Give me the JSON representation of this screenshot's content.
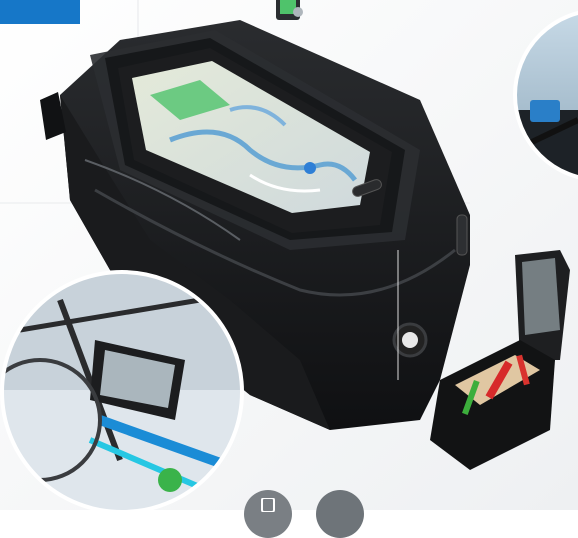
{
  "product": {
    "name": "",
    "badge_color": "#1677c8",
    "icons": [
      "phone-touch-icon",
      "phone-icon"
    ]
  }
}
